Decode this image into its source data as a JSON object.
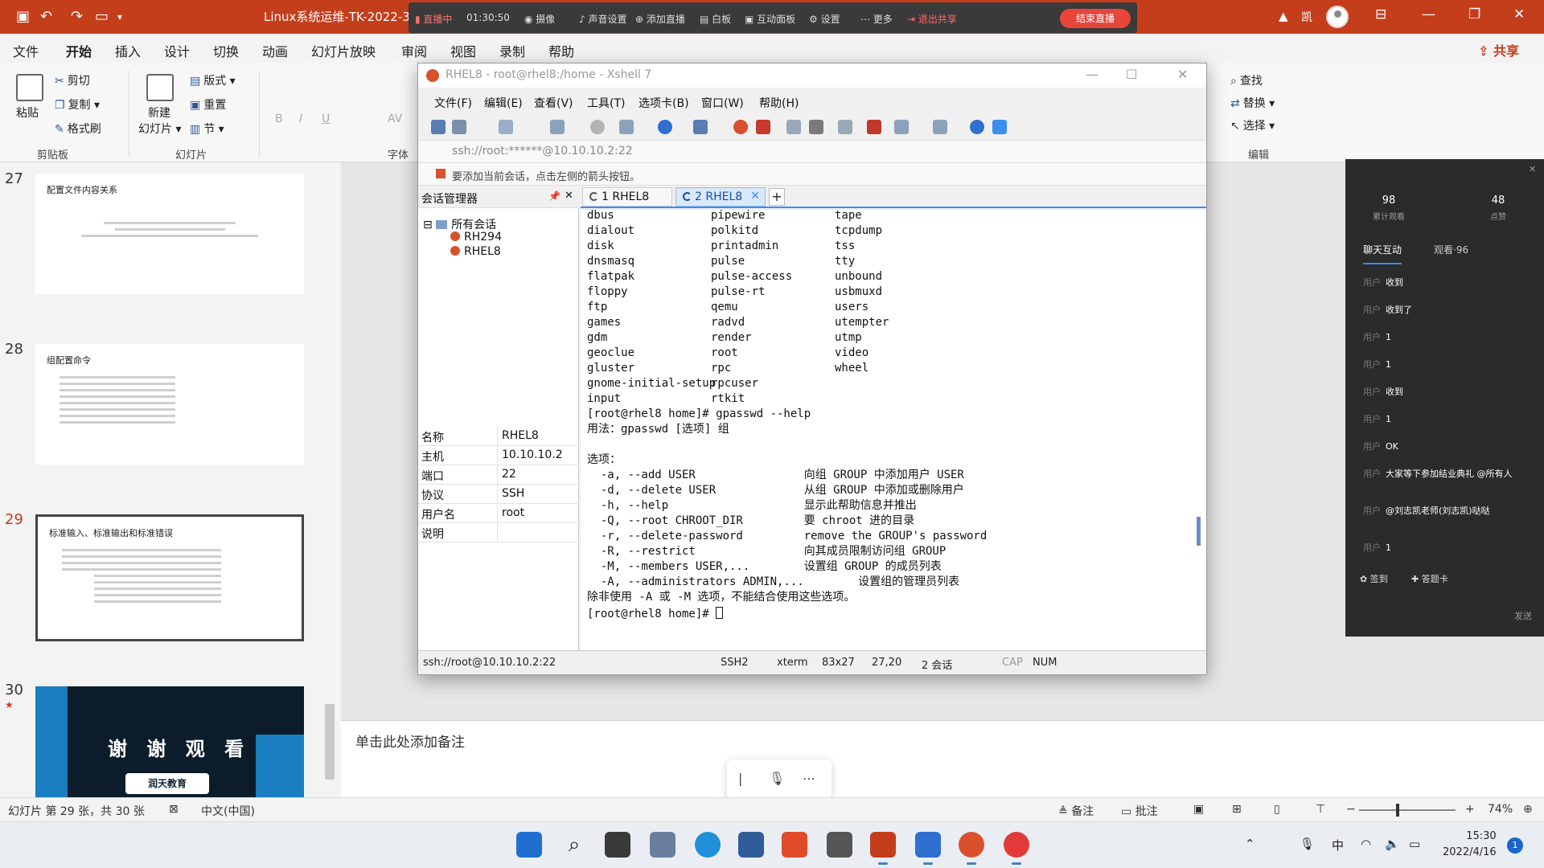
{
  "titlebar": {
    "doc_title": "Linux系统运维-TK-2022-3",
    "save_icon": "save-icon",
    "undo_icon": "undo-icon",
    "redo_icon": "redo-icon",
    "present_icon": "present-icon"
  },
  "livebar": {
    "status": "直播中",
    "elapsed": "01:30:50",
    "items": [
      "摄像",
      "声音设置",
      "添加直播",
      "白板",
      "互动面板",
      "设置",
      "更多",
      "退出共享"
    ],
    "end_button": "结束直播"
  },
  "ribbon_tabs": [
    "文件",
    "开始",
    "插入",
    "设计",
    "切换",
    "动画",
    "幻灯片放映",
    "审阅",
    "视图",
    "录制",
    "帮助"
  ],
  "active_tab": "开始",
  "share_label": "共享",
  "ribbon": {
    "paste": "粘贴",
    "cut": "剪切",
    "copy": "复制",
    "format_painter": "格式刷",
    "clipboard_group": "剪贴板",
    "new_slide": "新建",
    "new_slide_2": "幻灯片",
    "layout": "版式",
    "reset": "重置",
    "section": "节",
    "slides_group": "幻灯片",
    "font_group": "字体",
    "find": "查找",
    "replace": "替换",
    "select": "选择",
    "editing_group": "编辑"
  },
  "slides": [
    {
      "num": "27",
      "title": "配置文件内容关系"
    },
    {
      "num": "28",
      "title": "组配置命令"
    },
    {
      "num": "29",
      "title": "标准输入、标准输出和标准错误"
    },
    {
      "num": "30",
      "title": "谢 谢 观 看",
      "logo": "润天教育"
    }
  ],
  "notes_placeholder": "单击此处添加备注",
  "xshell": {
    "window_title": "RHEL8 - root@rhel8:/home - Xshell 7",
    "menu": [
      "文件(F)",
      "编辑(E)",
      "查看(V)",
      "工具(T)",
      "选项卡(B)",
      "窗口(W)",
      "帮助(H)"
    ],
    "address": "ssh://root:******@10.10.10.2:22",
    "hint": "要添加当前会话，点击左侧的箭头按钮。",
    "session_manager": "会话管理器",
    "tree_root": "所有会话",
    "sessions": [
      "RH294",
      "RHEL8"
    ],
    "props": [
      {
        "k": "名称",
        "v": "RHEL8"
      },
      {
        "k": "主机",
        "v": "10.10.10.2"
      },
      {
        "k": "端口",
        "v": "22"
      },
      {
        "k": "协议",
        "v": "SSH"
      },
      {
        "k": "用户名",
        "v": "root"
      },
      {
        "k": "说明",
        "v": ""
      }
    ],
    "tabs": [
      "1 RHEL8",
      "2 RHEL8"
    ],
    "terminal": {
      "col1": [
        "dbus",
        "dialout",
        "disk",
        "dnsmasq",
        "flatpak",
        "floppy",
        "ftp",
        "games",
        "gdm",
        "geoclue",
        "gluster",
        "gnome-initial-setup",
        "input"
      ],
      "col2": [
        "pipewire",
        "polkitd",
        "printadmin",
        "pulse",
        "pulse-access",
        "pulse-rt",
        "qemu",
        "radvd",
        "render",
        "root",
        "rpc",
        "rpcuser",
        "rtkit"
      ],
      "col3": [
        "tape",
        "tcpdump",
        "tss",
        "tty",
        "unbound",
        "usbmuxd",
        "users",
        "utempter",
        "utmp",
        "video",
        "wheel"
      ],
      "lines": [
        "[root@rhel8 home]# gpasswd --help",
        "用法：gpasswd [选项] 组",
        "",
        "选项：",
        "  -a, --add USER                向组 GROUP 中添加用户 USER",
        "  -d, --delete USER             从组 GROUP 中添加或删除用户",
        "  -h, --help                    显示此帮助信息并推出",
        "  -Q, --root CHROOT_DIR         要 chroot 进的目录",
        "  -r, --delete-password         remove the GROUP's password",
        "  -R, --restrict                向其成员限制访问组 GROUP",
        "  -M, --members USER,...        设置组 GROUP 的成员列表",
        "  -A, --administrators ADMIN,...        设置组的管理员列表",
        "除非使用 -A 或 -M 选项，不能结合使用这些选项。",
        "[root@rhel8 home]# "
      ]
    },
    "status": {
      "conn": "ssh://root@10.10.10.2:22",
      "proto": "SSH2",
      "term": "xterm",
      "size": "83x27",
      "pos": "27,20",
      "sessions": "2 会话",
      "cap": "CAP",
      "num": "NUM"
    }
  },
  "chat": {
    "stats": [
      {
        "value": "98",
        "label": "累计观看"
      },
      {
        "value": "48",
        "label": "点赞"
      }
    ],
    "tabs": [
      "聊天互动",
      "观看·96"
    ],
    "messages": [
      {
        "who": "用户",
        "text": "收到"
      },
      {
        "who": "用户",
        "text": "收到了"
      },
      {
        "who": "用户",
        "text": "1"
      },
      {
        "who": "用户",
        "text": "1"
      },
      {
        "who": "用户",
        "text": "收到"
      },
      {
        "who": "用户",
        "text": "1"
      },
      {
        "who": "用户",
        "text": "OK"
      },
      {
        "who": "用户",
        "text": "大家等下参加结业典礼 @所有人"
      },
      {
        "who": "用户",
        "text": "@刘志凯老师(刘志凯)哒哒"
      },
      {
        "who": "用户",
        "text": "1"
      }
    ],
    "sign_in": "签到",
    "answer_card": "答题卡",
    "send": "发送"
  },
  "statusbar": {
    "slide_info": "幻灯片 第 29 张，共 30 张",
    "language": "中文(中国)",
    "notes": "备注",
    "comments": "批注",
    "zoom": "74%"
  },
  "taskbar": {
    "time": "15:30",
    "date": "2022/4/16",
    "notif_count": "1",
    "ime": "中"
  }
}
